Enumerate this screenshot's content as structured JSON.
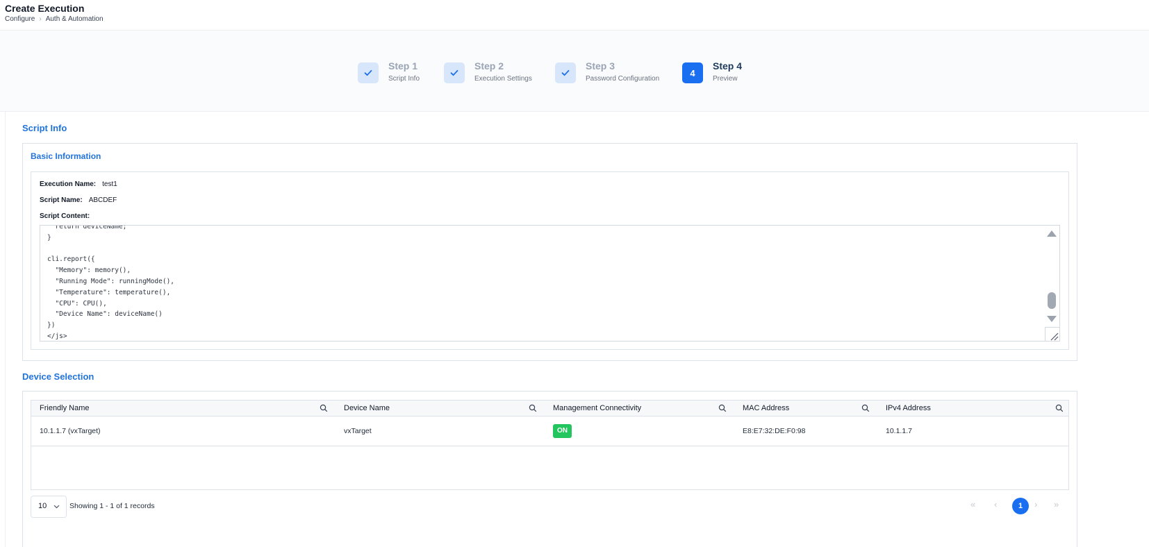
{
  "header": {
    "title": "Create Execution",
    "breadcrumb": [
      "Configure",
      "Auth & Automation"
    ]
  },
  "stepper": {
    "steps": [
      {
        "number": "1",
        "title": "Step 1",
        "subtitle": "Script Info",
        "status": "completed"
      },
      {
        "number": "2",
        "title": "Step 2",
        "subtitle": "Execution Settings",
        "status": "completed"
      },
      {
        "number": "3",
        "title": "Step 3",
        "subtitle": "Password Configuration",
        "status": "completed"
      },
      {
        "number": "4",
        "title": "Step 4",
        "subtitle": "Preview",
        "status": "active"
      }
    ]
  },
  "script_info": {
    "section_title": "Script Info",
    "card_title": "Basic Information",
    "execution_name_label": "Execution Name:",
    "execution_name": "test1",
    "script_name_label": "Script Name:",
    "script_name": "ABCDEF",
    "script_content_label": "Script Content:",
    "script_content": "  return deviceName;\n}\n\ncli.report({\n  \"Memory\": memory(),\n  \"Running Mode\": runningMode(),\n  \"Temperature\": temperature(),\n  \"CPU\": CPU(),\n  \"Device Name\": deviceName()\n})\n</js>"
  },
  "device_selection": {
    "section_title": "Device Selection",
    "columns": [
      "Friendly Name",
      "Device Name",
      "Management Connectivity",
      "MAC Address",
      "IPv4 Address"
    ],
    "rows": [
      {
        "friendly_name": "10.1.1.7 (vxTarget)",
        "device_name": "vxTarget",
        "connectivity": "ON",
        "mac": "E8:E7:32:DE:F0:98",
        "ipv4": "10.1.1.7"
      }
    ],
    "page_size": "10",
    "records_text": "Showing 1 - 1 of 1 records",
    "current_page": "1"
  },
  "colors": {
    "accent": "#1a6ff0",
    "section_title": "#2173dc",
    "status_on": "#22c55e"
  }
}
